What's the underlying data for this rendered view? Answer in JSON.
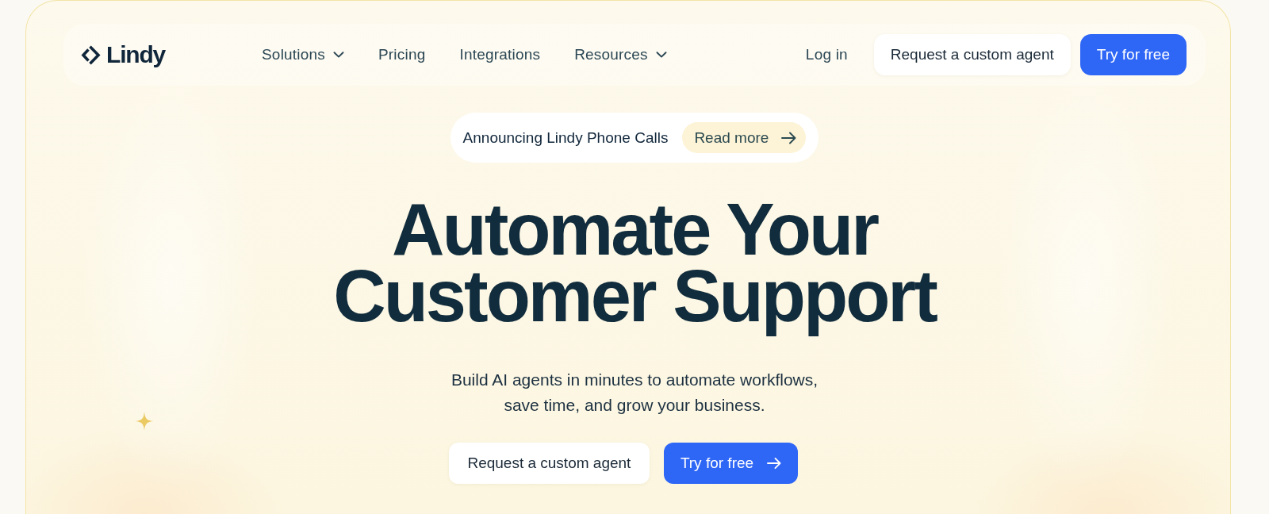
{
  "nav": {
    "logo": "Lindy",
    "links": [
      {
        "label": "Solutions",
        "dropdown": true
      },
      {
        "label": "Pricing",
        "dropdown": false
      },
      {
        "label": "Integrations",
        "dropdown": false
      },
      {
        "label": "Resources",
        "dropdown": true
      }
    ],
    "login": "Log in",
    "buttons": [
      {
        "label": "Request a custom agent",
        "kind": "secondary"
      },
      {
        "label": "Try for free",
        "kind": "primary"
      }
    ]
  },
  "announcement": {
    "text": "Announcing Lindy Phone Calls",
    "link": "Read more"
  },
  "hero": {
    "headline": "Automate Your Customer Support",
    "subtitle": "Build AI agents in minutes to automate workflows, save time, and grow your business.",
    "buttons": [
      {
        "label": "Request a custom agent",
        "kind": "secondary",
        "arrow": false
      },
      {
        "label": "Try for free",
        "kind": "primary",
        "arrow": true
      }
    ]
  }
}
